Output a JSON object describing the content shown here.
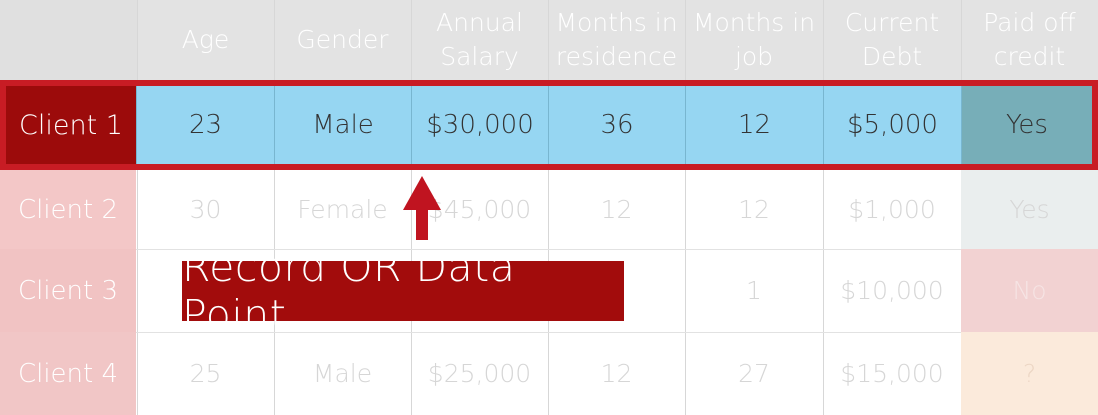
{
  "table": {
    "headers": [
      "Age",
      "Gender",
      "Annual\nSalary",
      "Months in\nresidence",
      "Months in\njob",
      "Current\nDebt",
      "Paid off\ncredit"
    ],
    "rows": [
      {
        "label": "Client 1",
        "cells": [
          "23",
          "Male",
          "$30,000",
          "36",
          "12",
          "$5,000",
          "Yes"
        ]
      },
      {
        "label": "Client 2",
        "cells": [
          "30",
          "Female",
          "$45,000",
          "12",
          "12",
          "$1,000",
          "Yes"
        ]
      },
      {
        "label": "Client 3",
        "cells": [
          "",
          "",
          "",
          "",
          "1",
          "$10,000",
          "No"
        ]
      },
      {
        "label": "Client 4",
        "cells": [
          "25",
          "Male",
          "$25,000",
          "12",
          "27",
          "$15,000",
          "?"
        ]
      }
    ]
  },
  "callout": {
    "text": "Record OR Data Point"
  },
  "colors": {
    "highlight_border": "#c81c24",
    "highlight_label": "#9c0b0b",
    "highlight_cells": "#96d6f2",
    "callout_bg": "#a20c0c",
    "arrow": "#c01420"
  }
}
